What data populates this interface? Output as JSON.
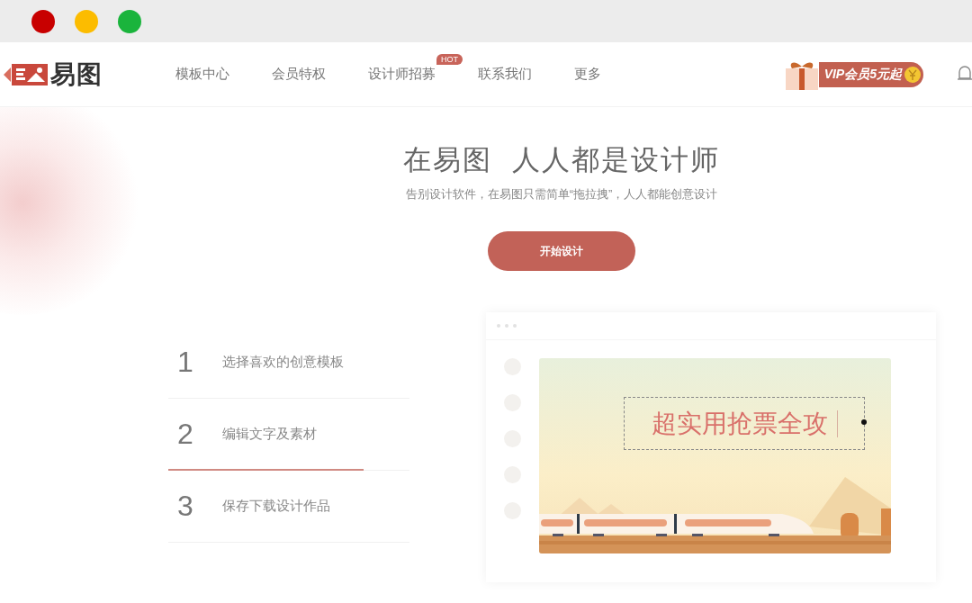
{
  "logo": {
    "text": "易图"
  },
  "nav": {
    "items": [
      {
        "label": "模板中心"
      },
      {
        "label": "会员特权"
      },
      {
        "label": "设计师招募",
        "badge": "HOT"
      },
      {
        "label": "联系我们"
      },
      {
        "label": "更多"
      }
    ],
    "vip": "VIP会员5元起"
  },
  "hero": {
    "title": "在易图  人人都是设计师",
    "subtitle": "告别设计软件，在易图只需简单“拖拉拽”，人人都能创意设计",
    "button": "开始设计"
  },
  "steps": [
    {
      "number": "1",
      "label": "选择喜欢的创意模板",
      "selected": false
    },
    {
      "number": "2",
      "label": "编辑文字及素材",
      "selected": true
    },
    {
      "number": "3",
      "label": "保存下载设计作品",
      "selected": false
    }
  ],
  "preview": {
    "canvas_text": "超实用抢票全攻"
  }
}
